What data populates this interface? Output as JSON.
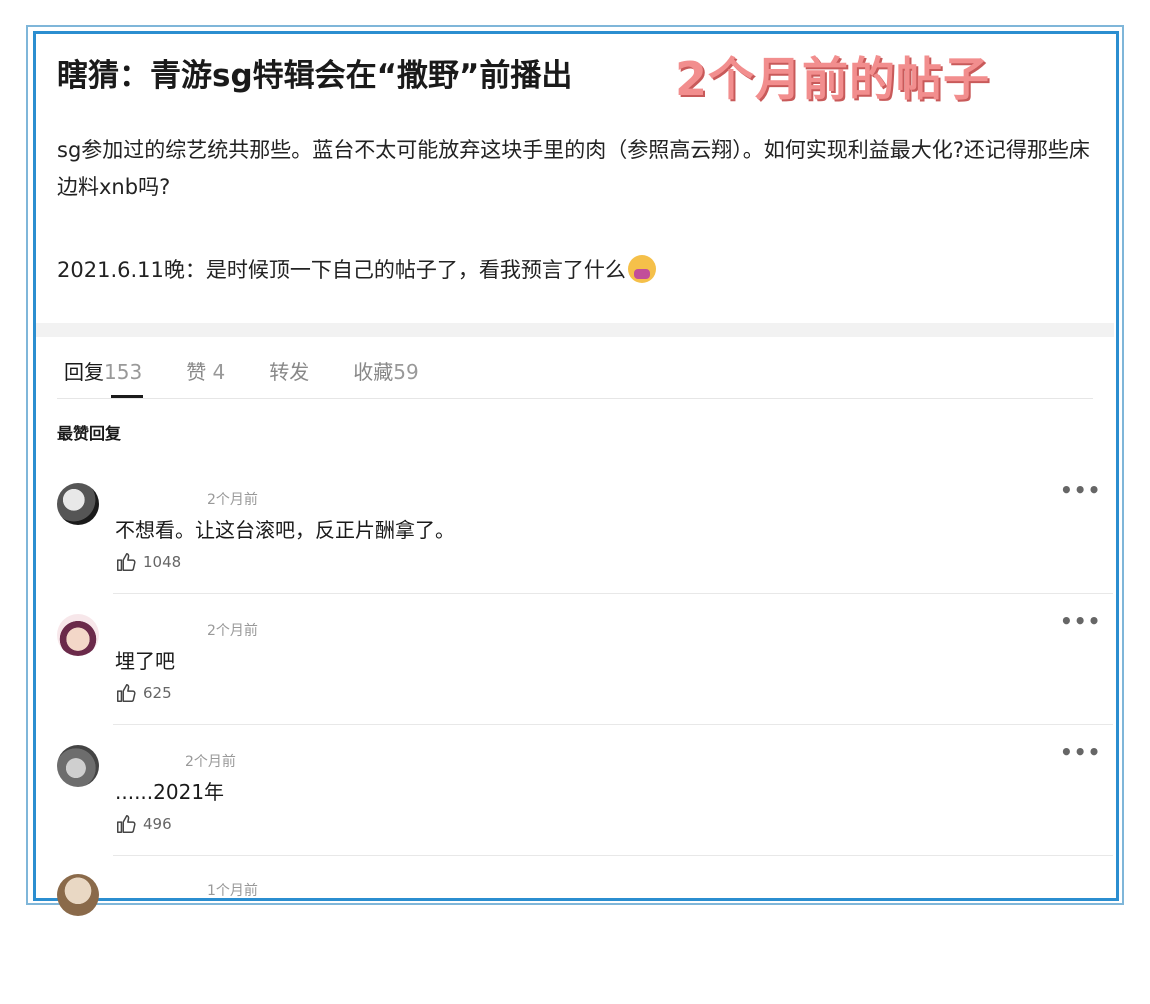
{
  "post": {
    "title": "瞎猜：青游sg特辑会在“撒野”前播出",
    "overlay_label": "2个月前的帖子",
    "paragraph1": "sg参加过的综艺统共那些。蓝台不太可能放弃这块手里的肉（参照高云翔）。如何实现利益最大化?还记得那些床边料xnb吗?",
    "paragraph2": "2021.6.11晚：是时候顶一下自己的帖子了，看我预言了什么",
    "paragraph2_emoji": "person-shrugging-emoji"
  },
  "tabs": [
    {
      "label": "回复",
      "count": "153",
      "active": true
    },
    {
      "label": "赞",
      "count": "4",
      "active": false
    },
    {
      "label": "转发",
      "count": "",
      "active": false
    },
    {
      "label": "收藏",
      "count": "59",
      "active": false
    }
  ],
  "section_title": "最赞回复",
  "comments": [
    {
      "time": "2个月前",
      "text": "不想看。让这台滚吧，反正片酬拿了。",
      "likes": "1048"
    },
    {
      "time": "2个月前",
      "text": "埋了吧",
      "likes": "625"
    },
    {
      "time": "2个月前",
      "text": "......2021年",
      "likes": "496"
    },
    {
      "time": "1个月前",
      "text": "",
      "likes": ""
    }
  ],
  "colors": {
    "frame_border": "#2b8ed0",
    "overlay_text": "#f28e8e",
    "muted_text": "#999999"
  }
}
